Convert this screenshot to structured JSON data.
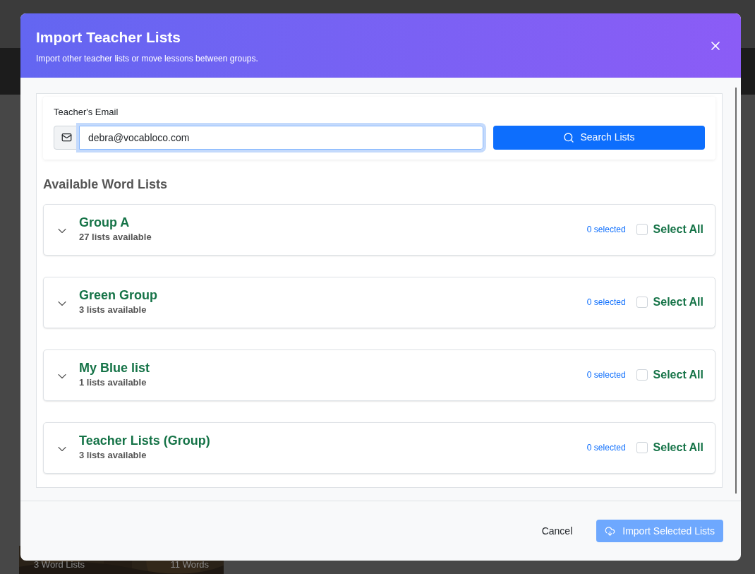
{
  "background": {
    "card": {
      "lists": "3 Word Lists",
      "words": "11 Words"
    }
  },
  "dialog": {
    "title": "Import Teacher Lists",
    "subtitle": "Import other teacher lists or move lessons between groups.",
    "email": {
      "label": "Teacher's Email",
      "value": "debra@vocabloco.com",
      "focused": true
    },
    "search_button": "Search Lists",
    "section_title": "Available Word Lists",
    "groups": [
      {
        "name": "Group A",
        "count": "27 lists available",
        "selected_count": "0 selected",
        "select_all": "Select All",
        "checked": false,
        "expanded": false
      },
      {
        "name": "Green Group",
        "count": "3 lists available",
        "selected_count": "0 selected",
        "select_all": "Select All",
        "checked": false,
        "expanded": false
      },
      {
        "name": "My Blue list",
        "count": "1 lists available",
        "selected_count": "0 selected",
        "select_all": "Select All",
        "checked": false,
        "expanded": false
      },
      {
        "name": "Teacher Lists (Group)",
        "count": "3 lists available",
        "selected_count": "0 selected",
        "select_all": "Select All",
        "checked": false,
        "expanded": false
      }
    ],
    "cancel_button": "Cancel",
    "import_button": {
      "label": "Import Selected Lists",
      "disabled": true
    }
  }
}
